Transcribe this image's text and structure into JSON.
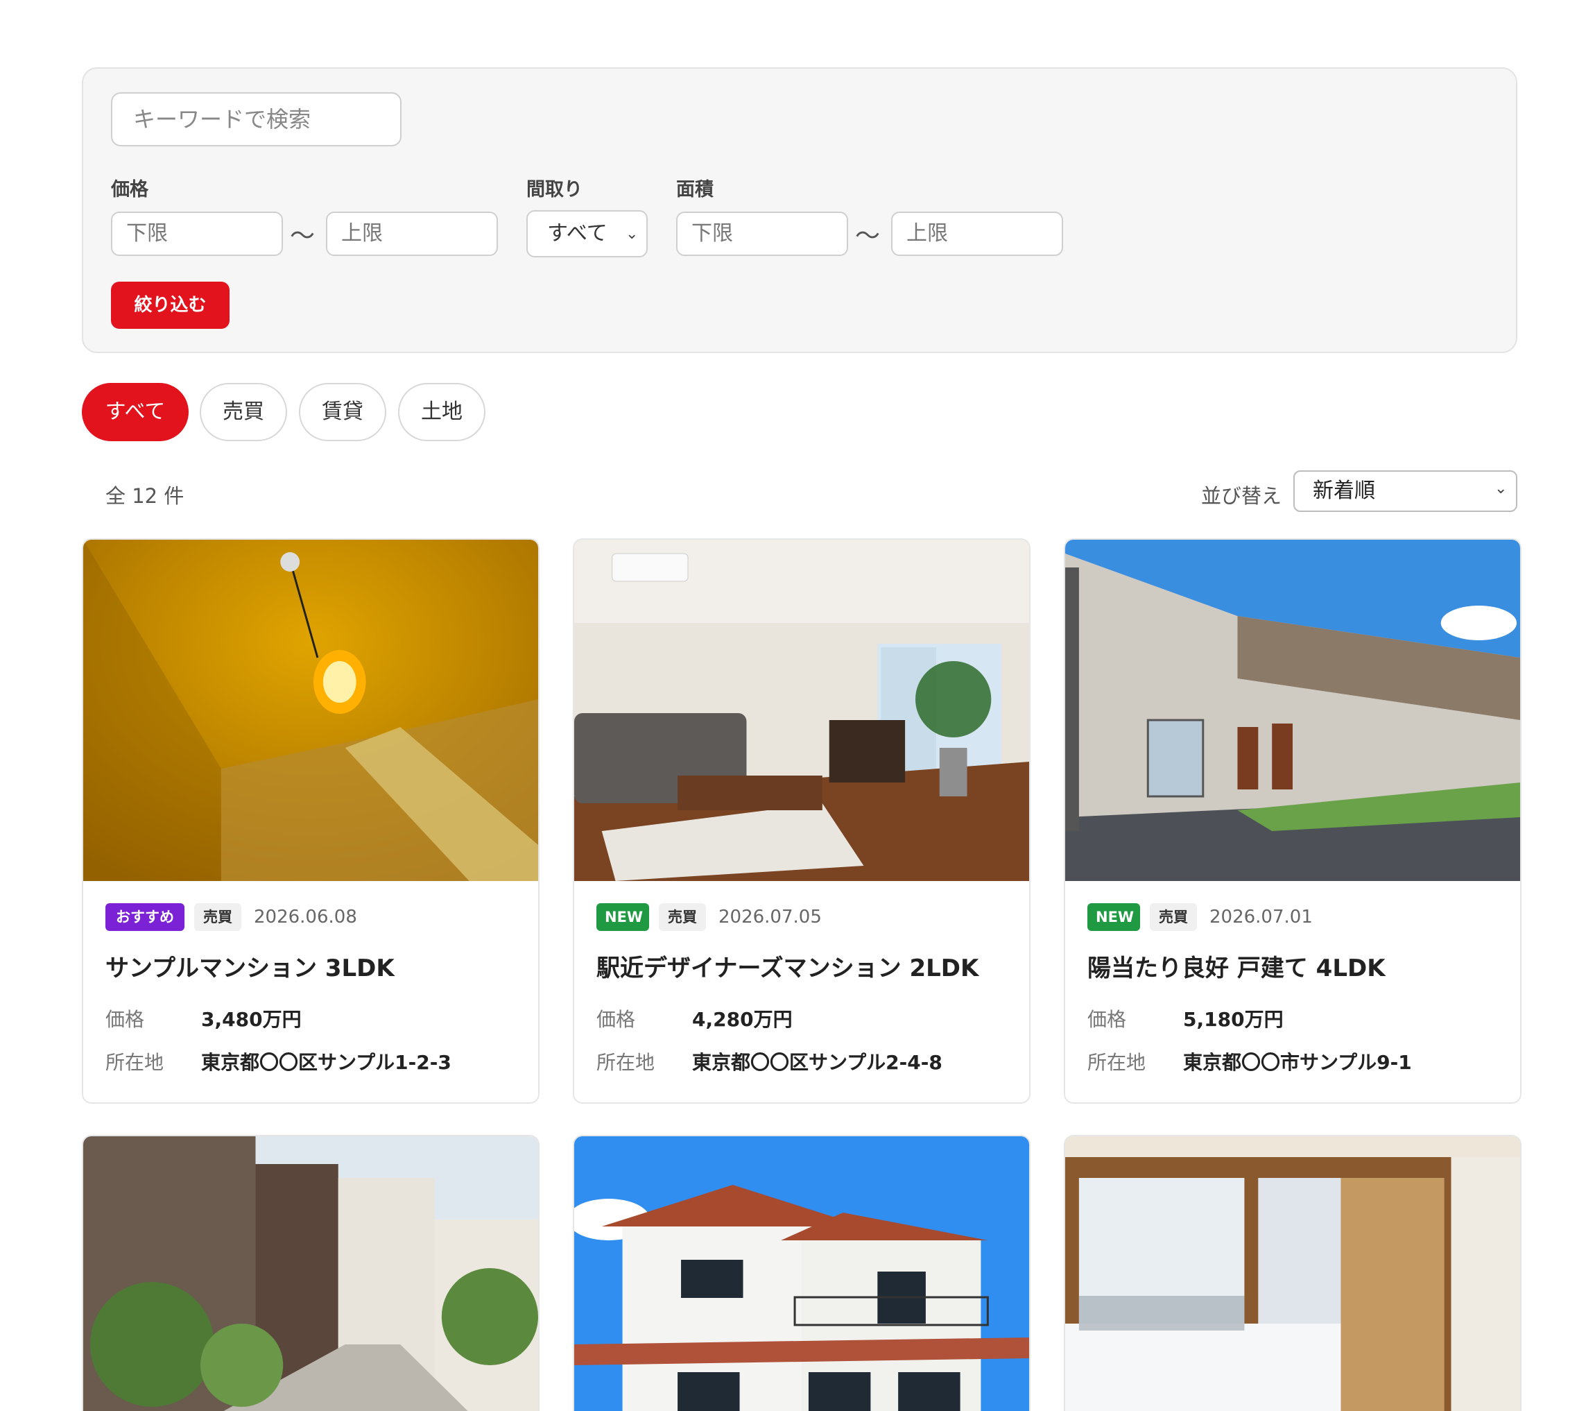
{
  "filters": {
    "keyword_placeholder": "キーワードで検索",
    "price_label": "価格",
    "layout_label": "間取り",
    "area_label": "面積",
    "min_placeholder": "下限",
    "max_placeholder": "上限",
    "tilde": "〜",
    "layout_value": "すべて",
    "apply_label": "絞り込む"
  },
  "tabs": [
    {
      "label": "すべて",
      "active": true
    },
    {
      "label": "売買",
      "active": false
    },
    {
      "label": "賃貸",
      "active": false
    },
    {
      "label": "土地",
      "active": false
    }
  ],
  "results": {
    "count_text": "全 12 件",
    "sort_label": "並び替え",
    "sort_value": "新着順"
  },
  "labels": {
    "price": "価格",
    "location": "所在地"
  },
  "cards": [
    {
      "badge": "おすすめ",
      "badge_type": "rec",
      "kind": "売買",
      "date": "2026.06.08",
      "title": "サンプルマンション 3LDK",
      "price": "3,480万円",
      "location": "東京都〇〇区サンプル1-2-3"
    },
    {
      "badge": "NEW",
      "badge_type": "new",
      "kind": "売買",
      "date": "2026.07.05",
      "title": "駅近デザイナーズマンション 2LDK",
      "price": "4,280万円",
      "location": "東京都〇〇区サンプル2-4-8"
    },
    {
      "badge": "NEW",
      "badge_type": "new",
      "kind": "売買",
      "date": "2026.07.01",
      "title": "陽当たり良好 戸建て 4LDK",
      "price": "5,180万円",
      "location": "東京都〇〇市サンプル9-1"
    }
  ],
  "colors": {
    "accent": "#e3131d",
    "badge_recommended": "#7b22d6",
    "badge_new": "#1f9a42"
  }
}
